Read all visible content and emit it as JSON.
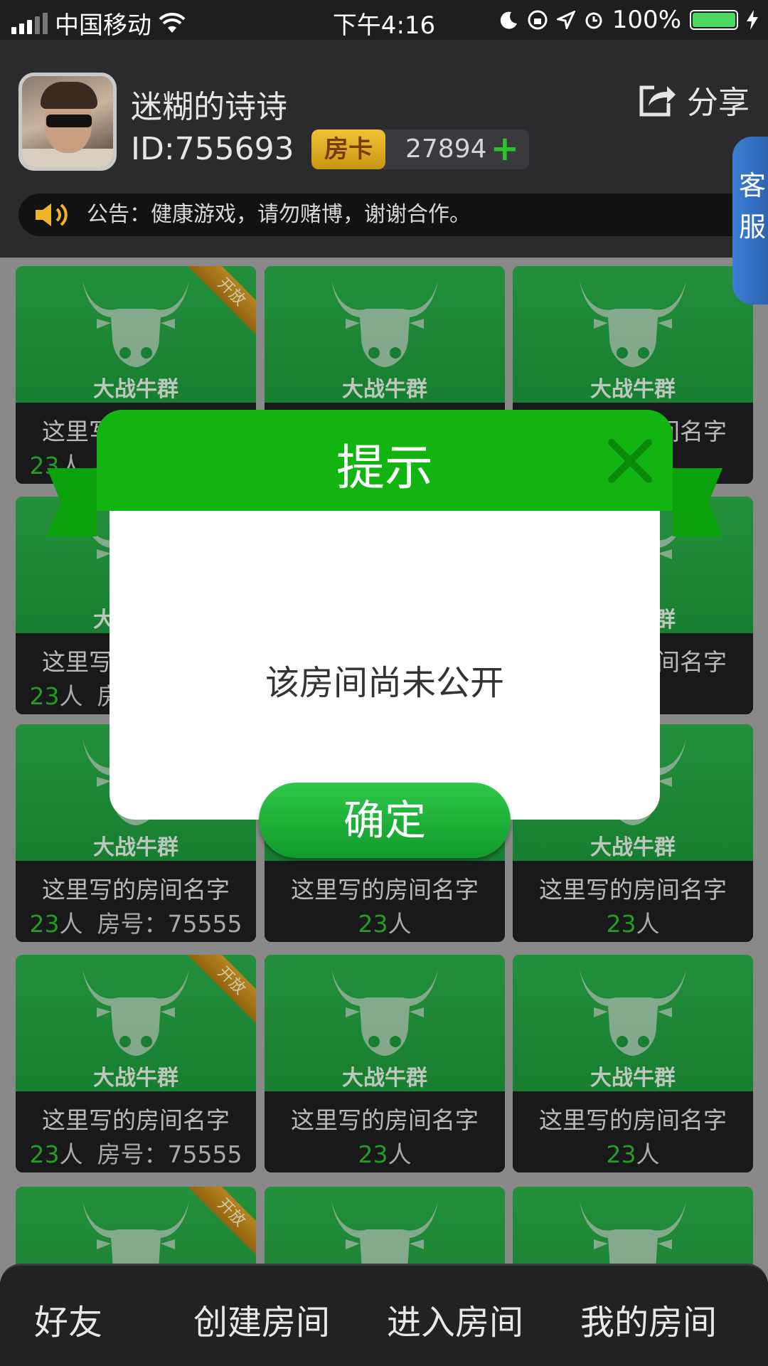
{
  "status_bar": {
    "carrier": "中国移动",
    "time": "下午4:16",
    "battery": "100%"
  },
  "header": {
    "username": "迷糊的诗诗",
    "user_id": "ID:755693",
    "room_card_label": "房卡",
    "room_card_count": "27894",
    "add_symbol": "+",
    "share_label": "分享",
    "notice": "公告：健康游戏，请勿赌博，谢谢合作。",
    "customer_service": "客服"
  },
  "rooms": {
    "game_name": "大战牛群",
    "open_badge": "开放",
    "room_name": "这里写的房间名字",
    "people_count": "23",
    "people_unit": "人",
    "room_no_label": "房号：",
    "room_no": "75555"
  },
  "dialog": {
    "title": "提示",
    "message": "该房间尚未公开",
    "confirm_label": "确定"
  },
  "tabbar": {
    "items": [
      "好友",
      "创建房间",
      "进入房间",
      "我的房间"
    ]
  },
  "colors": {
    "accent_green": "#11b411",
    "card_gold": "#e0a22a",
    "count_green": "#2ec02e"
  }
}
